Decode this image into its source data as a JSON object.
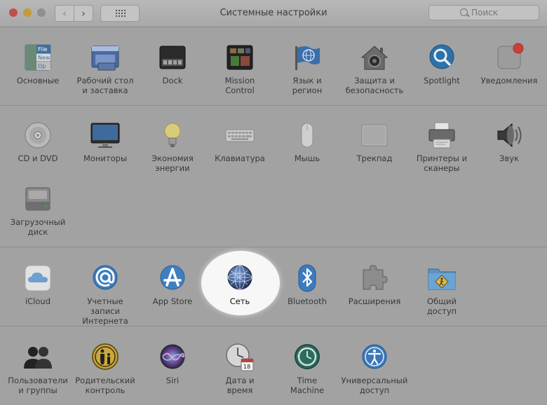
{
  "window": {
    "title": "Системные настройки",
    "search_placeholder": "Поиск",
    "nav": {
      "back": "‹",
      "forward": "›"
    }
  },
  "highlighted": "Сеть",
  "sections": [
    {
      "items": [
        {
          "id": "general",
          "label": "Основные",
          "icon": "file-window-icon"
        },
        {
          "id": "desktop",
          "label": "Рабочий стол\nи заставка",
          "icon": "desktop-screensaver-icon"
        },
        {
          "id": "dock",
          "label": "Dock",
          "icon": "dock-icon"
        },
        {
          "id": "mission",
          "label": "Mission\nControl",
          "icon": "mission-control-icon"
        },
        {
          "id": "language",
          "label": "Язык и\nрегион",
          "icon": "flag-globe-icon"
        },
        {
          "id": "security",
          "label": "Защита и\nбезопасность",
          "icon": "house-camera-icon"
        },
        {
          "id": "spotlight",
          "label": "Spotlight",
          "icon": "magnifier-icon"
        },
        {
          "id": "notifications",
          "label": "Уведомления",
          "icon": "notification-badge-icon"
        }
      ]
    },
    {
      "items": [
        {
          "id": "cd",
          "label": "CD и DVD",
          "icon": "disc-icon"
        },
        {
          "id": "displays",
          "label": "Мониторы",
          "icon": "monitor-icon"
        },
        {
          "id": "energy",
          "label": "Экономия\nэнергии",
          "icon": "lightbulb-icon"
        },
        {
          "id": "keyboard",
          "label": "Клавиатура",
          "icon": "keyboard-icon"
        },
        {
          "id": "mouse",
          "label": "Мышь",
          "icon": "mouse-icon"
        },
        {
          "id": "trackpad",
          "label": "Трекпад",
          "icon": "trackpad-icon"
        },
        {
          "id": "printers",
          "label": "Принтеры и\nсканеры",
          "icon": "printer-icon"
        },
        {
          "id": "sound",
          "label": "Звук",
          "icon": "speaker-icon"
        },
        {
          "id": "startup",
          "label": "Загрузочный\nдиск",
          "icon": "hard-drive-icon"
        }
      ]
    },
    {
      "items": [
        {
          "id": "icloud",
          "label": "iCloud",
          "icon": "cloud-icon"
        },
        {
          "id": "internet",
          "label": "Учетные записи\nИнтернета",
          "icon": "at-sign-icon"
        },
        {
          "id": "appstore",
          "label": "App Store",
          "icon": "app-store-icon"
        },
        {
          "id": "network",
          "label": "Сеть",
          "icon": "network-globe-icon"
        },
        {
          "id": "bluetooth",
          "label": "Bluetooth",
          "icon": "bluetooth-icon"
        },
        {
          "id": "extensions",
          "label": "Расширения",
          "icon": "puzzle-piece-icon"
        },
        {
          "id": "sharing",
          "label": "Общий\nдоступ",
          "icon": "shared-folder-icon"
        }
      ]
    },
    {
      "items": [
        {
          "id": "users",
          "label": "Пользователи\nи группы",
          "icon": "users-silhouette-icon"
        },
        {
          "id": "parental",
          "label": "Родительский\nконтроль",
          "icon": "parental-control-icon"
        },
        {
          "id": "siri",
          "label": "Siri",
          "icon": "siri-orb-icon"
        },
        {
          "id": "datetime",
          "label": "Дата и\nвремя",
          "icon": "clock-calendar-icon"
        },
        {
          "id": "timemachine",
          "label": "Time\nMachine",
          "icon": "time-machine-icon"
        },
        {
          "id": "accessibility",
          "label": "Универсальный\nдоступ",
          "icon": "accessibility-figure-icon"
        }
      ]
    }
  ]
}
